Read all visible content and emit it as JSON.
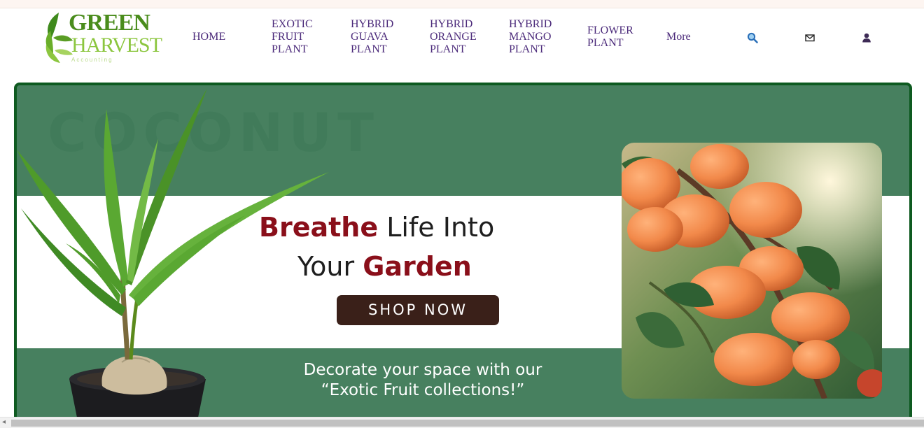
{
  "logo": {
    "line1": "GREEN",
    "line2": "HARVEST",
    "line3": "Accounting"
  },
  "nav": {
    "home": "HOME",
    "exotic": "EXOTIC\nFRUIT\nPLANT",
    "guava": "HYBRID\nGUAVA\nPLANT",
    "orange": "HYBRID\nORANGE\nPLANT",
    "mango": "HYBRID\nMANGO\nPLANT",
    "flower": "FLOWER\nPLANT",
    "more": "More"
  },
  "header_icons": [
    "search-icon",
    "mail-icon",
    "user-icon"
  ],
  "banner": {
    "watermark": "COCONUT",
    "headline_accent_1": "Breathe",
    "headline_rest_1": " Life Into",
    "headline_rest_2": "Your ",
    "headline_accent_2": "Garden",
    "button": "SHOP NOW",
    "tagline_1": "Decorate your space with our",
    "tagline_2": "“Exotic Fruit collections!”"
  },
  "colors": {
    "nav_text": "#4b2a7a",
    "banner_green": "#47805f",
    "banner_border": "#0e5a20",
    "accent_red": "#8a0f1a",
    "button_bg": "#3a2019",
    "logo_green": "#4a8c1c",
    "logo_light": "#8cc63f"
  }
}
